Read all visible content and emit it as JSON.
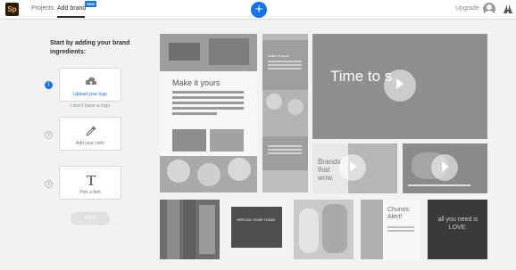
{
  "app": {
    "logo_text": "Sp"
  },
  "nav": {
    "projects": "Projects",
    "add_brand": "Add brand",
    "new_badge": "NEW",
    "upgrade": "Upgrade"
  },
  "sidebar": {
    "title": "Start by adding your brand ingredients:",
    "steps": [
      {
        "number": "1",
        "label": "Upload your logo",
        "sub": "I don't have a logo"
      },
      {
        "number": "2",
        "label": "Add your color"
      },
      {
        "number": "3",
        "label": "Pick a font"
      }
    ],
    "next": "Next"
  },
  "gallery": {
    "make_it_yours": "Make it yours",
    "make_it_yours_small": "Make it yours",
    "time_to": "Time to s",
    "brands": "Brands that wow.",
    "chunos": "Chunos Alert!",
    "all_you_need": "all you need is LOVE.",
    "special": "SPECIAL YOUR TODAY"
  },
  "colors": {
    "accent": "#1473e6",
    "logo_bg": "#2b1a0e",
    "logo_fg": "#f5b52b"
  }
}
